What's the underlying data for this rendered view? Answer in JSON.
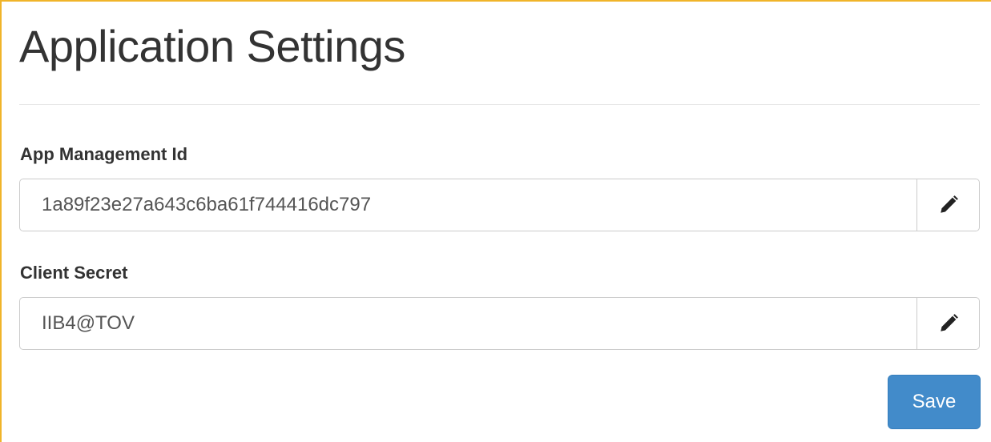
{
  "page": {
    "title": "Application Settings"
  },
  "fields": [
    {
      "label": "App Management Id",
      "value": "1a89f23e27a643c6ba61f744416dc797",
      "action_icon": "pencil-icon"
    },
    {
      "label": "Client Secret",
      "value": "IIB4@TOV",
      "action_icon": "pencil-icon"
    }
  ],
  "actions": {
    "save_label": "Save"
  },
  "colors": {
    "accent_border": "#f0b429",
    "primary_button": "#428bca",
    "text": "#333333"
  }
}
